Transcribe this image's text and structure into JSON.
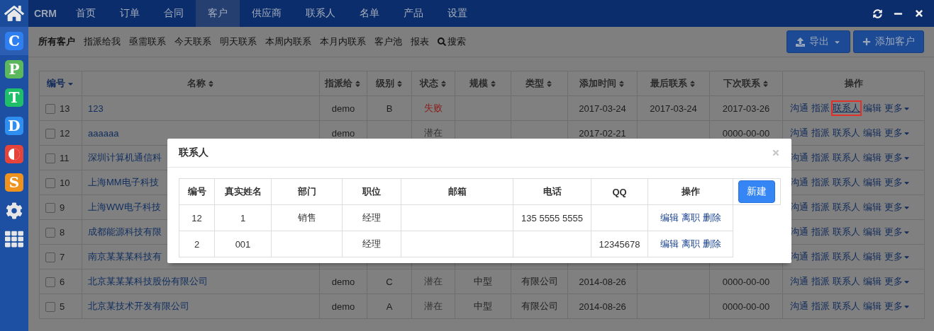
{
  "topbar": {
    "brand": "CRM",
    "nav": [
      {
        "label": "首页",
        "selected": false
      },
      {
        "label": "订单",
        "selected": false
      },
      {
        "label": "合同",
        "selected": false
      },
      {
        "label": "客户",
        "selected": true
      },
      {
        "label": "供应商",
        "selected": false
      },
      {
        "label": "联系人",
        "selected": false
      },
      {
        "label": "名单",
        "selected": false
      },
      {
        "label": "产品",
        "selected": false
      },
      {
        "label": "设置",
        "selected": false
      }
    ]
  },
  "sidebar": {
    "apps": [
      {
        "kind": "letter",
        "label": "C",
        "color": "#2f7ff0",
        "selected": true
      },
      {
        "kind": "letter",
        "label": "P",
        "color": "#5cb85c",
        "selected": false
      },
      {
        "kind": "letter",
        "label": "T",
        "color": "#1fbf6a",
        "selected": false
      },
      {
        "kind": "letter",
        "label": "D",
        "color": "#2f8ff0",
        "selected": false
      },
      {
        "kind": "half",
        "color": "#e5443a",
        "selected": false
      },
      {
        "kind": "letter",
        "label": "S",
        "color": "#f0931e",
        "selected": false
      },
      {
        "kind": "gear",
        "selected": false
      },
      {
        "kind": "grid",
        "selected": false
      }
    ]
  },
  "subnav": {
    "items": [
      {
        "label": "所有客户",
        "selected": true
      },
      {
        "label": "指派给我",
        "selected": false
      },
      {
        "label": "亟需联系",
        "selected": false
      },
      {
        "label": "今天联系",
        "selected": false
      },
      {
        "label": "明天联系",
        "selected": false
      },
      {
        "label": "本周内联系",
        "selected": false
      },
      {
        "label": "本月内联系",
        "selected": false
      },
      {
        "label": "客户池",
        "selected": false
      },
      {
        "label": "报表",
        "selected": false
      },
      {
        "label": "搜索",
        "selected": false,
        "kind": "search"
      }
    ],
    "buttons": [
      {
        "kind": "export",
        "label": "导出"
      },
      {
        "kind": "add",
        "label": "添加客户"
      }
    ]
  },
  "table": {
    "columns": [
      {
        "label": "编号",
        "sorted": true
      },
      {
        "label": "名称",
        "sorted": false
      },
      {
        "label": "指派给",
        "sorted": false
      },
      {
        "label": "级别",
        "sorted": false
      },
      {
        "label": "状态",
        "sorted": false
      },
      {
        "label": "规模",
        "sorted": false
      },
      {
        "label": "类型",
        "sorted": false
      },
      {
        "label": "添加时间",
        "sorted": false
      },
      {
        "label": "最后联系",
        "sorted": false
      },
      {
        "label": "下次联系",
        "sorted": false
      },
      {
        "label": "操作",
        "sorted": false,
        "kind": "plain"
      }
    ],
    "rows": [
      {
        "checked": false,
        "id": "13",
        "name": "123",
        "assignee": "demo",
        "level": "B",
        "status": {
          "text": "失败",
          "color": "#8b1c1c"
        },
        "added": "2017-03-24",
        "last": "2017-03-24",
        "next": "2017-03-26",
        "actions": [
          {
            "label": "沟通",
            "highlighted": false
          },
          {
            "label": "指派",
            "highlighted": false
          },
          {
            "label": "联系人",
            "highlighted": true
          },
          {
            "label": "编辑",
            "highlighted": false
          },
          {
            "label": "更多",
            "highlighted": false,
            "kind": "menu"
          }
        ]
      },
      {
        "checked": false,
        "id": "12",
        "name": "aaaaaa",
        "assignee": "demo",
        "status": {
          "text": "潜在",
          "color": "#333333"
        },
        "added": "2017-02-21",
        "next": "0000-00-00",
        "actions": [
          {
            "label": "沟通",
            "highlighted": false
          },
          {
            "label": "指派",
            "highlighted": false
          },
          {
            "label": "联系人",
            "highlighted": false
          },
          {
            "label": "编辑",
            "highlighted": false
          },
          {
            "label": "更多",
            "highlighted": false,
            "kind": "menu"
          }
        ]
      },
      {
        "checked": false,
        "id": "11",
        "name": "深圳计算机通信科",
        "actions": [
          {
            "label": "沟通",
            "highlighted": false
          },
          {
            "label": "指派",
            "highlighted": false
          },
          {
            "label": "联系人",
            "highlighted": false
          },
          {
            "label": "编辑",
            "highlighted": false
          },
          {
            "label": "更多",
            "highlighted": false,
            "kind": "menu"
          }
        ]
      },
      {
        "checked": false,
        "id": "10",
        "name": "上海MM电子科技",
        "actions": [
          {
            "label": "沟通",
            "highlighted": false
          },
          {
            "label": "指派",
            "highlighted": false
          },
          {
            "label": "联系人",
            "highlighted": false
          },
          {
            "label": "编辑",
            "highlighted": false
          },
          {
            "label": "更多",
            "highlighted": false,
            "kind": "menu"
          }
        ]
      },
      {
        "checked": false,
        "id": "9",
        "name": "上海WW电子科技",
        "actions": [
          {
            "label": "沟通",
            "highlighted": false
          },
          {
            "label": "指派",
            "highlighted": false
          },
          {
            "label": "联系人",
            "highlighted": false
          },
          {
            "label": "编辑",
            "highlighted": false
          },
          {
            "label": "更多",
            "highlighted": false,
            "kind": "menu"
          }
        ]
      },
      {
        "checked": false,
        "id": "8",
        "name": "成都能源科技有限",
        "actions": [
          {
            "label": "沟通",
            "highlighted": false
          },
          {
            "label": "指派",
            "highlighted": false
          },
          {
            "label": "联系人",
            "highlighted": false
          },
          {
            "label": "编辑",
            "highlighted": false
          },
          {
            "label": "更多",
            "highlighted": false,
            "kind": "menu"
          }
        ]
      },
      {
        "checked": false,
        "id": "7",
        "name": "南京某某某科技有",
        "actions": [
          {
            "label": "沟通",
            "highlighted": false
          },
          {
            "label": "指派",
            "highlighted": false
          },
          {
            "label": "联系人",
            "highlighted": false
          },
          {
            "label": "编辑",
            "highlighted": false
          },
          {
            "label": "更多",
            "highlighted": false,
            "kind": "menu"
          }
        ]
      },
      {
        "checked": false,
        "id": "6",
        "name": "北京某某某科技股份有限公司",
        "assignee": "demo",
        "level": "C",
        "status": {
          "text": "潜在",
          "color": "#333333"
        },
        "scale": "中型",
        "type": "有限公司",
        "added": "2014-08-26",
        "next": "0000-00-00",
        "actions": [
          {
            "label": "沟通",
            "highlighted": false
          },
          {
            "label": "指派",
            "highlighted": false
          },
          {
            "label": "联系人",
            "highlighted": false
          },
          {
            "label": "编辑",
            "highlighted": false
          },
          {
            "label": "更多",
            "highlighted": false,
            "kind": "menu"
          }
        ]
      },
      {
        "checked": false,
        "id": "5",
        "name": "北京某技术开发有限公司",
        "assignee": "demo",
        "level": "A",
        "status": {
          "text": "潜在",
          "color": "#333333"
        },
        "scale": "中型",
        "type": "有限公司",
        "added": "2014-08-26",
        "next": "0000-00-00",
        "actions": [
          {
            "label": "沟通",
            "highlighted": false
          },
          {
            "label": "指派",
            "highlighted": false
          },
          {
            "label": "联系人",
            "highlighted": false
          },
          {
            "label": "编辑",
            "highlighted": false
          },
          {
            "label": "更多",
            "highlighted": false,
            "kind": "menu"
          }
        ]
      }
    ]
  },
  "dialog": {
    "title": "联系人",
    "columns": [
      "编号",
      "真实姓名",
      "部门",
      "职位",
      "邮箱",
      "电话",
      "QQ",
      "操作"
    ],
    "rows": [
      {
        "cells": [
          "12",
          "1",
          "销售",
          "经理",
          null,
          "135 5555 5555",
          null
        ],
        "actions": [
          "编辑",
          "离职",
          "删除"
        ]
      },
      {
        "cells": [
          "2",
          "001",
          null,
          "经理",
          null,
          null,
          "12345678"
        ],
        "actions": [
          "编辑",
          "离职",
          "删除"
        ]
      }
    ],
    "button": "新建"
  }
}
